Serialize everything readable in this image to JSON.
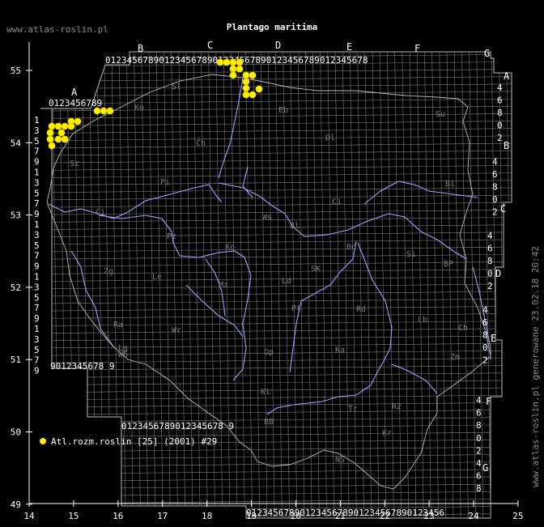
{
  "header": {
    "site": "www.atlas-roslin.pl",
    "title": "Plantago maritima",
    "vertical_note": "www.atlas-roslin.pl generowane 23.02.18 20:42"
  },
  "legend": {
    "label": "Atl.rozm.roslin [25] (2001) #29",
    "marker_color": "#ffee00"
  },
  "axes": {
    "lon_ticks": [
      "14",
      "15",
      "16",
      "17",
      "18",
      "19",
      "20",
      "21",
      "22",
      "23",
      "24",
      "25"
    ],
    "lat_ticks": [
      "55",
      "54",
      "53",
      "52",
      "51",
      "50",
      "49"
    ]
  },
  "grid_letters": {
    "top": [
      "A",
      "B",
      "C",
      "D",
      "E",
      "F",
      "G"
    ],
    "right": [
      "A",
      "B",
      "C",
      "D",
      "E",
      "F",
      "G"
    ]
  },
  "grid_digit_rows": {
    "A_top": "0123456789",
    "B_top": "0123456789012345678901234567890123456789012345678",
    "bottom_1": "9012345678 9",
    "bottom_2": "0123456789012345678 9",
    "bottom_3": "0123456789012345678901234567890123456"
  },
  "regions": [
    "Sl",
    "Ko",
    "Eb",
    "Ol",
    "Ch",
    "Su",
    "Pi",
    "Bi",
    "Ci",
    "Ws",
    "Bl",
    "Sz",
    "Pz",
    "Ko",
    "Mz",
    "Ld",
    "SK",
    "Si",
    "BP",
    "Le",
    "Ra",
    "Pt",
    "Rd",
    "Lb",
    "Ch",
    "Zg",
    "Lg",
    "Wr",
    "Op",
    "Ka",
    "Zm",
    "Wb",
    "Kt",
    "Tr",
    "Rz",
    "NS",
    "Kr",
    "BB",
    "Ci",
    "Bd"
  ],
  "colors": {
    "background": "#000000",
    "grid": "#7d7d7d",
    "border": "#bbbbbb",
    "rivers": "#9aa6ff",
    "text": "#ffffff",
    "points": "#ffee00"
  },
  "occurrence_count": 29
}
